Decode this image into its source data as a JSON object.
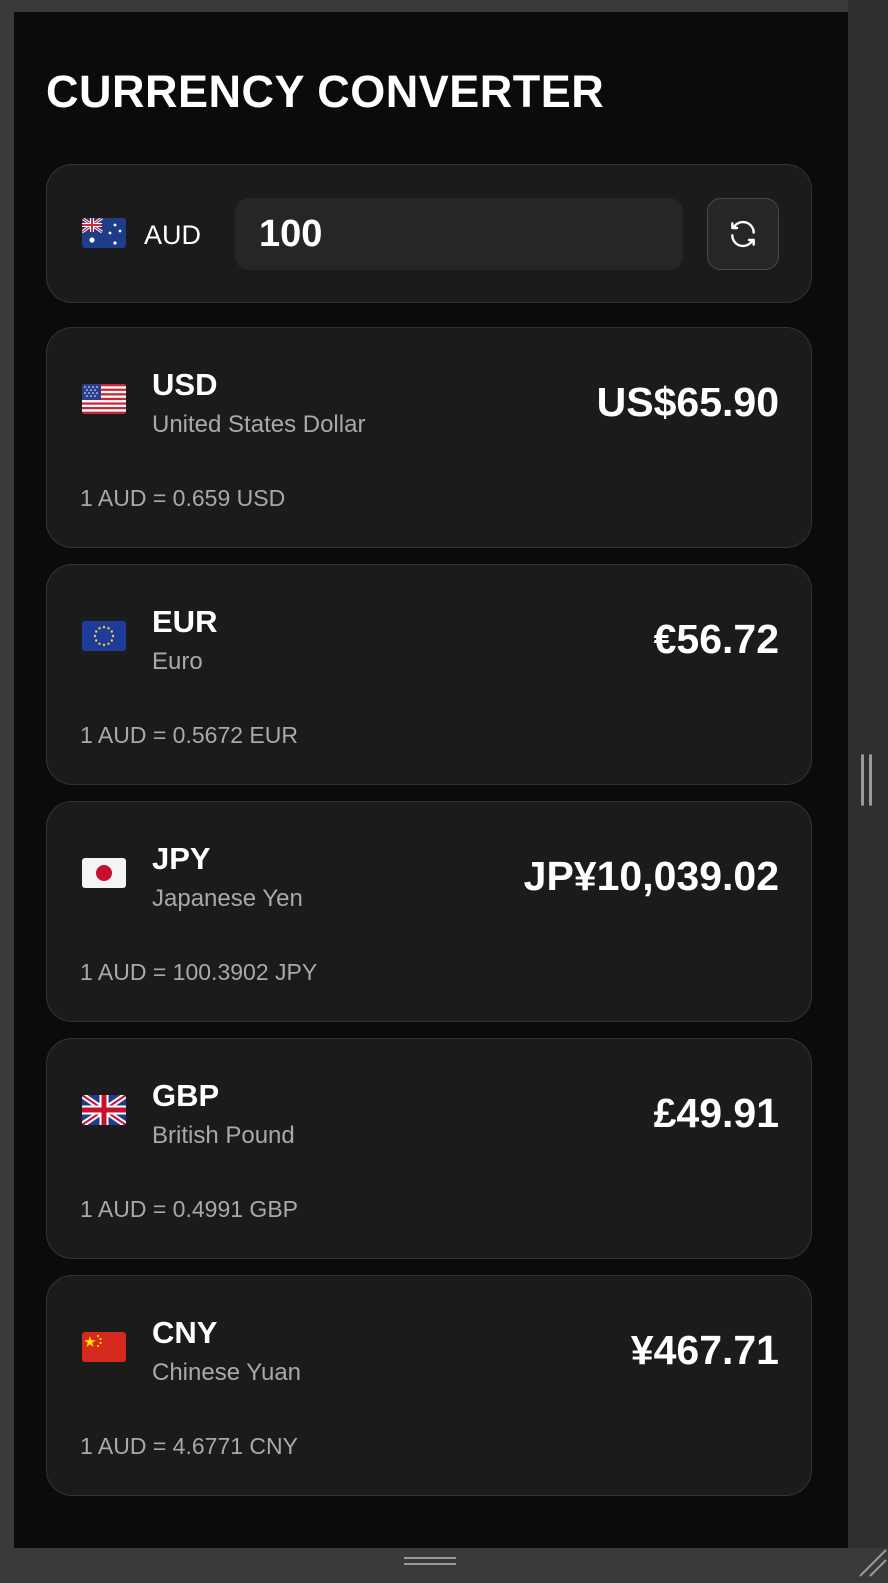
{
  "app": {
    "title": "CURRENCY CONVERTER"
  },
  "converter": {
    "base_currency": "AUD",
    "base_flag": "australia-flag-icon",
    "amount_value": "100",
    "refresh_icon": "refresh-icon"
  },
  "rates": [
    {
      "code": "USD",
      "name": "United States Dollar",
      "value": "US$65.90",
      "rate_text": "1 AUD = 0.659 USD",
      "flag": "united-states-flag-icon"
    },
    {
      "code": "EUR",
      "name": "Euro",
      "value": "€56.72",
      "rate_text": "1 AUD = 0.5672 EUR",
      "flag": "european-union-flag-icon"
    },
    {
      "code": "JPY",
      "name": "Japanese Yen",
      "value": "JP¥10,039.02",
      "rate_text": "1 AUD = 100.3902 JPY",
      "flag": "japan-flag-icon"
    },
    {
      "code": "GBP",
      "name": "British Pound",
      "value": "£49.91",
      "rate_text": "1 AUD = 0.4991 GBP",
      "flag": "united-kingdom-flag-icon"
    },
    {
      "code": "CNY",
      "name": "Chinese Yuan",
      "value": "¥467.71",
      "rate_text": "1 AUD = 4.6771 CNY",
      "flag": "china-flag-icon"
    }
  ],
  "colors": {
    "background": "#0b0b0b",
    "card": "#1b1b1b",
    "card_border": "#333333",
    "text_primary": "#ffffff",
    "text_secondary": "#a9a9a9"
  }
}
